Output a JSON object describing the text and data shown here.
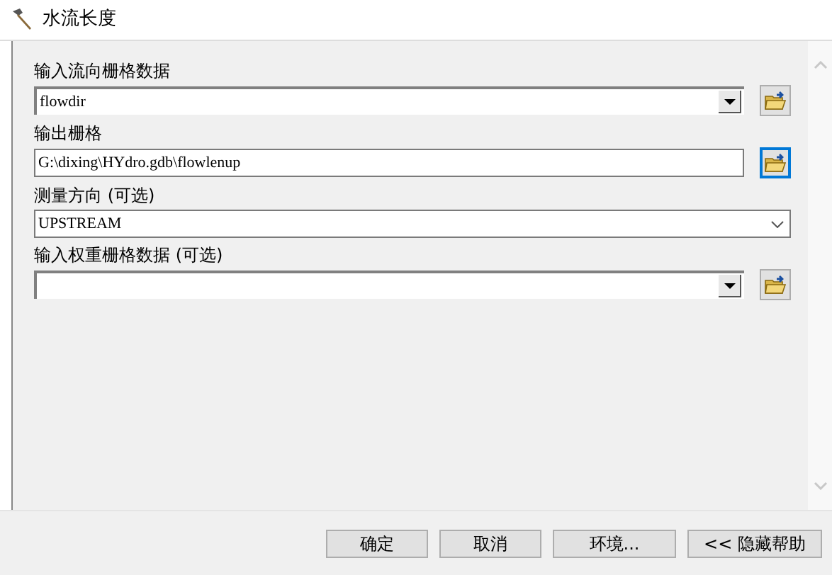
{
  "window": {
    "title": "水流长度"
  },
  "fields": [
    {
      "kind": "combo_browse",
      "label": "输入流向栅格数据",
      "value": "flowdir",
      "browse_focused": false
    },
    {
      "kind": "text_browse",
      "label": "输出栅格",
      "value": "G:\\dixing\\HYdro.gdb\\flowlenup",
      "browse_focused": true
    },
    {
      "kind": "dropdown",
      "label": "测量方向 (可选)",
      "value": "UPSTREAM"
    },
    {
      "kind": "combo_browse",
      "label": "输入权重栅格数据 (可选)",
      "browse_focused": false
    }
  ],
  "buttons": [
    {
      "label": "确定"
    },
    {
      "label": "取消"
    },
    {
      "label": "环境..."
    },
    {
      "label": "<< 隐藏帮助"
    }
  ]
}
